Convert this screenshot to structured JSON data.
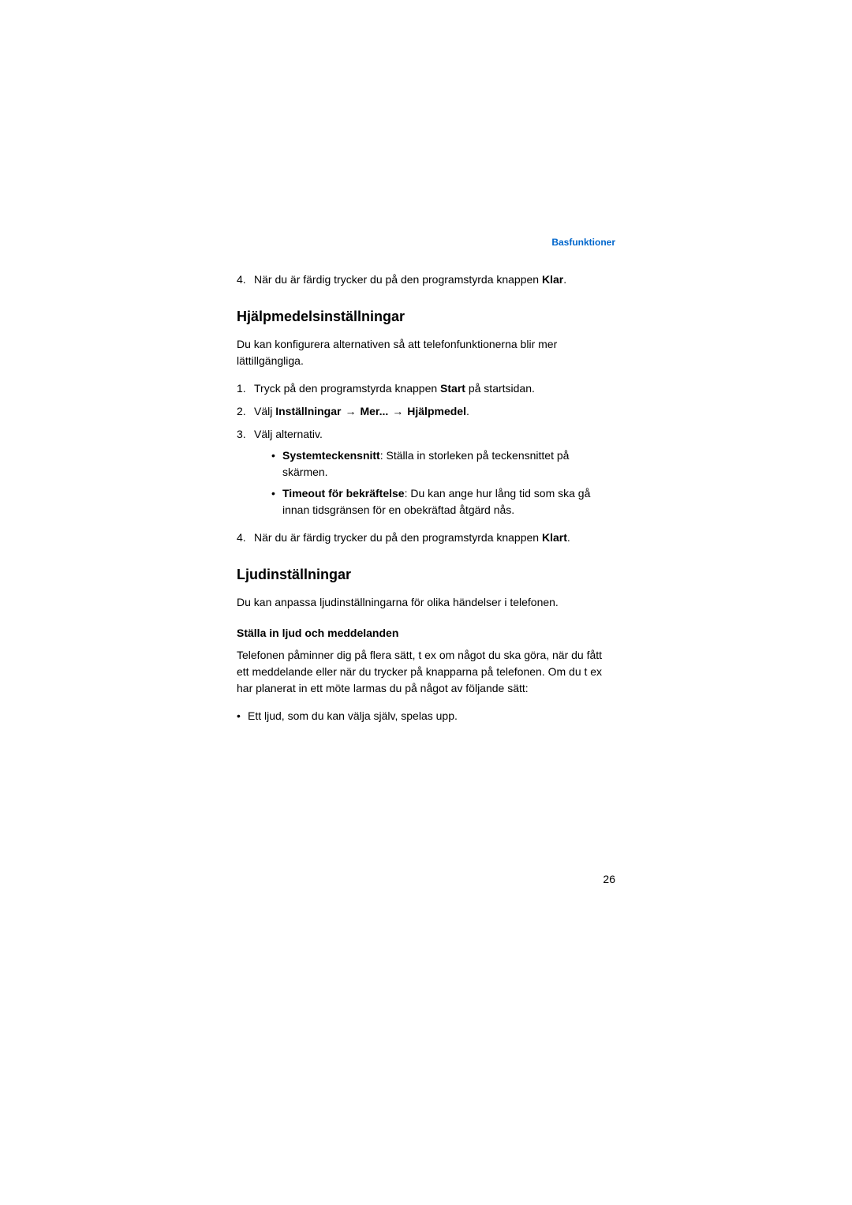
{
  "header": {
    "breadcrumb": "Basfunktioner"
  },
  "section1": {
    "step4_prefix": "4.",
    "step4_text_a": "När du är färdig trycker du på den programstyrda knappen ",
    "step4_bold": "Klar",
    "step4_text_b": "."
  },
  "section2": {
    "heading": "Hjälpmedelsinställningar",
    "intro": "Du kan konfigurera alternativen så att telefonfunktionerna blir mer lättillgängliga.",
    "step1_prefix": "1.",
    "step1_text_a": "Tryck på den programstyrda knappen ",
    "step1_bold": "Start",
    "step1_text_b": " på startsidan.",
    "step2_prefix": "2.",
    "step2_text_a": "Välj ",
    "step2_bold1": "Inställningar",
    "step2_sep1": " ",
    "step2_bold2": "Mer...",
    "step2_sep2": " ",
    "step2_bold3": "Hjälpmedel",
    "step2_text_b": ".",
    "step3_prefix": "3.",
    "step3_text": "Välj alternativ.",
    "step3_bullet1_bold": "Systemteckensnitt",
    "step3_bullet1_text": ": Ställa in storleken på teckensnittet på skärmen.",
    "step3_bullet2_bold": "Timeout för bekräftelse",
    "step3_bullet2_text": ": Du kan ange hur lång tid som ska gå innan tidsgränsen för en obekräftad åtgärd nås.",
    "step4_prefix": "4.",
    "step4_text_a": "När du är färdig trycker du på den programstyrda knappen ",
    "step4_bold": "Klart",
    "step4_text_b": "."
  },
  "section3": {
    "heading": "Ljudinställningar",
    "intro": "Du kan anpassa ljudinställningarna för olika händelser i telefonen.",
    "subheading": "Ställa in ljud och meddelanden",
    "para1": "Telefonen påminner dig på flera sätt, t ex om något du ska göra, när du fått ett meddelande eller när du trycker på knapparna på telefonen. Om du t ex har planerat in ett möte larmas du på något av följande sätt:",
    "bullet1": "Ett ljud, som du kan välja själv, spelas upp."
  },
  "pageNumber": "26",
  "glyphs": {
    "bullet": "•",
    "arrow": "→"
  }
}
